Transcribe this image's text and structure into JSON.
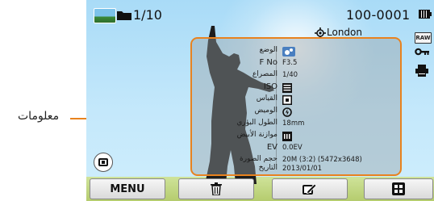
{
  "callout": {
    "label": "معلومات",
    "accent_color": "#e8821e"
  },
  "status_bar": {
    "folder_count": "1/10",
    "file_number": "100-0001",
    "location": "London"
  },
  "side_icons": {
    "raw_label": "RAW"
  },
  "info_rows": [
    {
      "label": "الوضع",
      "value": ""
    },
    {
      "label": "F No",
      "value": "F3.5"
    },
    {
      "label": "المصراع",
      "value": "1/40"
    },
    {
      "label": "ISO",
      "value": ""
    },
    {
      "label": "القياس",
      "value": ""
    },
    {
      "label": "الوميض",
      "value": ""
    },
    {
      "label": "الطول البؤري",
      "value": "18mm"
    },
    {
      "label": "موازنة الأبيض",
      "value": ""
    },
    {
      "label": "EV",
      "value": "0.0EV"
    },
    {
      "label": "حجم الصورة",
      "value": "20M (3:2) (5472x3648)"
    },
    {
      "label": "التاريخ",
      "value": "2013/01/01"
    }
  ],
  "iso_icon_text": "ISO\nAUTO",
  "wb_icon_text": "AUTO",
  "bottom_bar": {
    "menu_label": "MENU"
  }
}
